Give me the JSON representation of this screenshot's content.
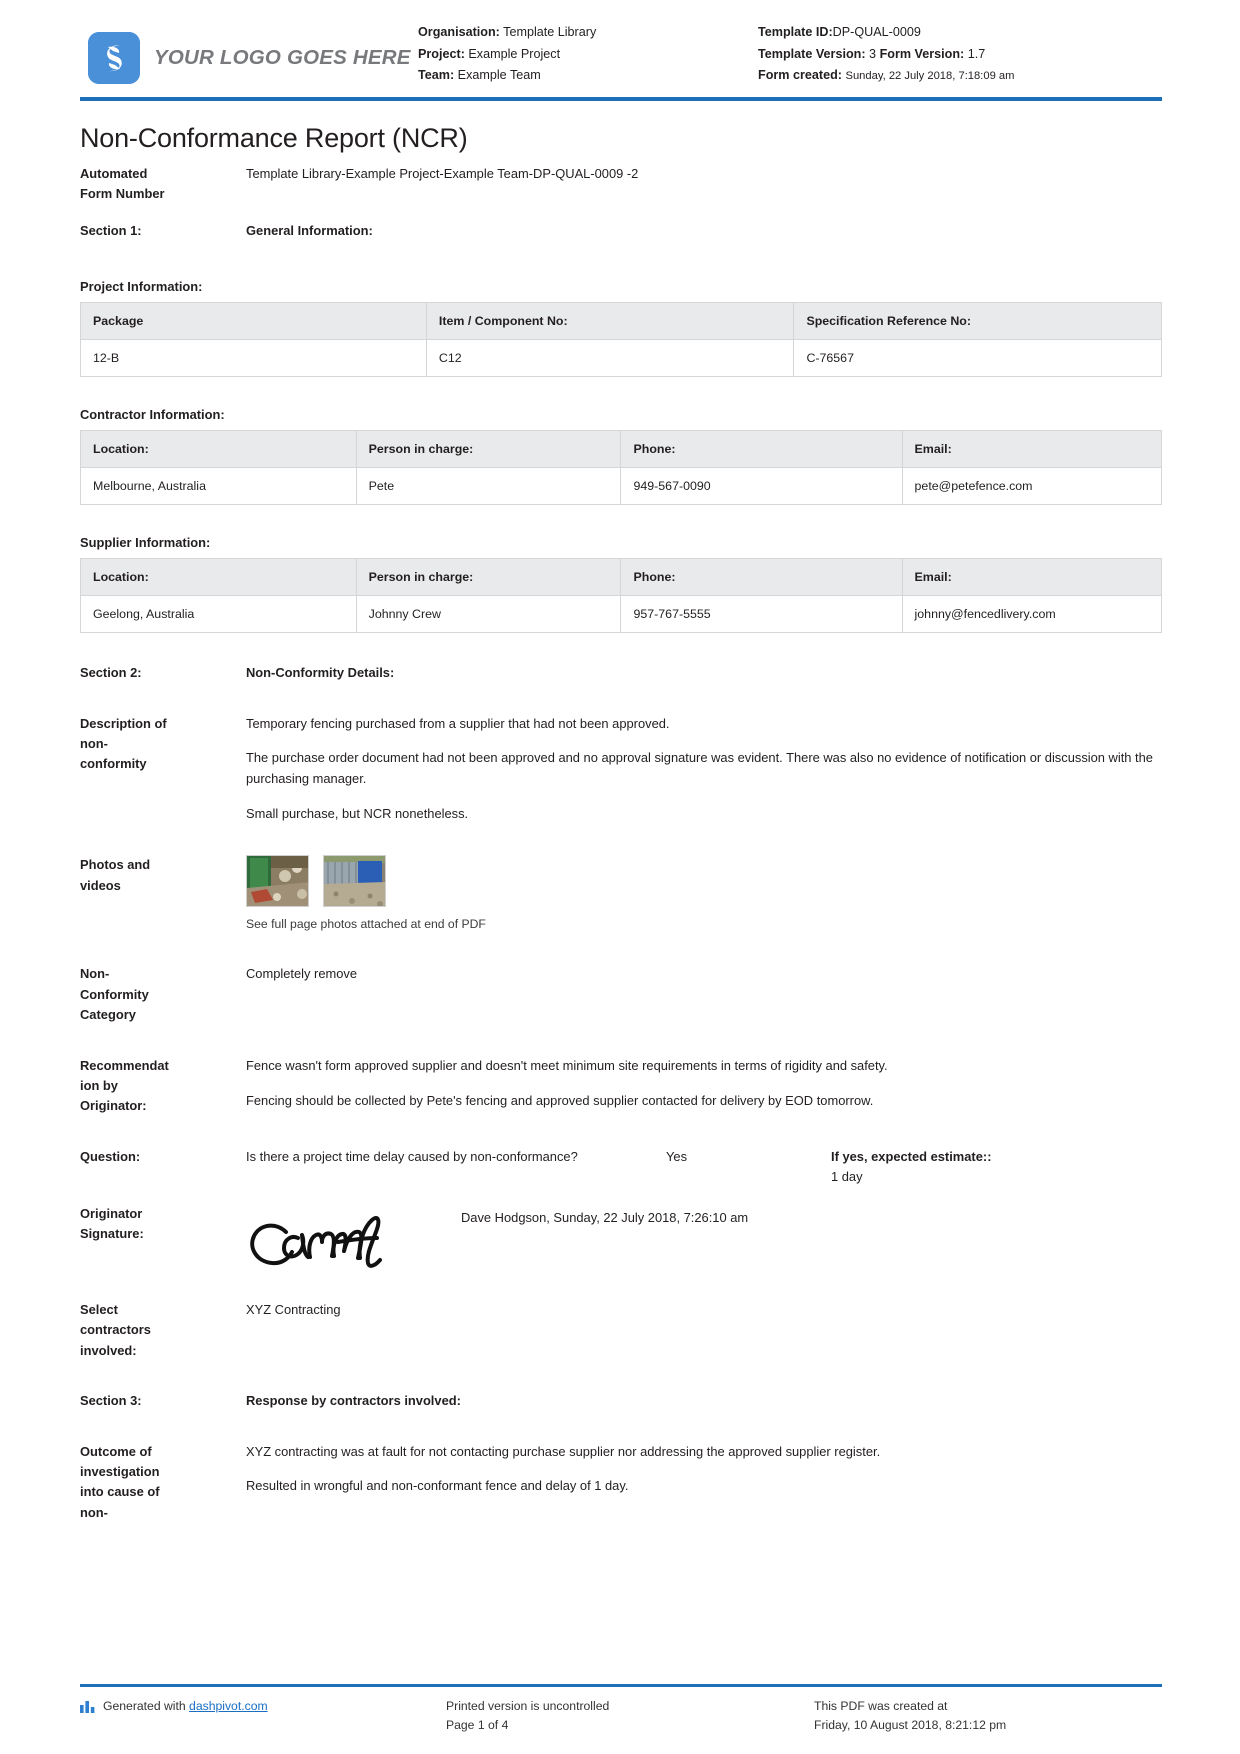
{
  "header": {
    "logo_text": "YOUR LOGO GOES HERE",
    "organisation_label": "Organisation:",
    "organisation_value": "Template Library",
    "project_label": "Project:",
    "project_value": "Example Project",
    "team_label": "Team:",
    "team_value": "Example Team",
    "template_id_label": "Template ID:",
    "template_id_value": "DP-QUAL-0009",
    "template_version_label": "Template Version:",
    "template_version_value": "3",
    "form_version_label": "Form Version:",
    "form_version_value": "1.7",
    "form_created_label": "Form created:",
    "form_created_value": "Sunday, 22 July 2018, 7:18:09 am"
  },
  "title": "Non-Conformance Report (NCR)",
  "automated_form": {
    "label_line1": "Automated",
    "label_line2": "Form Number",
    "value": "Template Library-Example Project-Example Team-DP-QUAL-0009   -2"
  },
  "section1": {
    "label": "Section 1:",
    "heading": "General Information:"
  },
  "project_information": {
    "heading": "Project Information:",
    "columns": [
      "Package",
      "Item / Component No:",
      "Specification Reference No:"
    ],
    "rows": [
      [
        "12-B",
        "C12",
        "C-76567"
      ]
    ]
  },
  "contractor_information": {
    "heading": "Contractor Information:",
    "columns": [
      "Location:",
      "Person in charge:",
      "Phone:",
      "Email:"
    ],
    "rows": [
      [
        "Melbourne, Australia",
        "Pete",
        "949-567-0090",
        "pete@petefence.com"
      ]
    ]
  },
  "supplier_information": {
    "heading": "Supplier Information:",
    "columns": [
      "Location:",
      "Person in charge:",
      "Phone:",
      "Email:"
    ],
    "rows": [
      [
        "Geelong, Australia",
        "Johnny Crew",
        "957-767-5555",
        "johnny@fencedlivery.com"
      ]
    ]
  },
  "section2": {
    "label": "Section 2:",
    "heading": "Non-Conformity Details:"
  },
  "description": {
    "label_line1": "Description of",
    "label_line2": "non-",
    "label_line3": "conformity",
    "paragraphs": [
      "Temporary fencing purchased from a supplier that had not been approved.",
      "The purchase order document had not been approved and no approval signature was evident. There was also no evidence of notification or discussion with the purchasing manager.",
      "Small purchase, but NCR nonetheless."
    ]
  },
  "photos": {
    "label_line1": "Photos and",
    "label_line2": "videos",
    "caption": "See full page photos attached at end of PDF",
    "count": 2
  },
  "category": {
    "label_line1": "Non-",
    "label_line2": "Conformity",
    "label_line3": "Category",
    "value": "Completely remove"
  },
  "recommendation": {
    "label_line1": "Recommendat",
    "label_line2": "ion by",
    "label_line3": "Originator:",
    "paragraphs": [
      "Fence wasn't form approved supplier and doesn't meet minimum site requirements in terms of rigidity and safety.",
      "Fencing should be collected by Pete's fencing and approved supplier contacted for delivery by EOD tomorrow."
    ]
  },
  "question": {
    "label": "Question:",
    "text": "Is there a project time delay caused by non-conformance?",
    "answer": "Yes",
    "estimate_label": "If yes, expected estimate::",
    "estimate_value": "1 day"
  },
  "signature": {
    "label_line1": "Originator",
    "label_line2": "Signature:",
    "meta": "Dave Hodgson, Sunday, 22 July 2018, 7:26:10 am"
  },
  "contractors": {
    "label_line1": "Select",
    "label_line2": "contractors",
    "label_line3": "involved:",
    "value": "XYZ Contracting"
  },
  "section3": {
    "label": "Section 3:",
    "heading": "Response by contractors involved:"
  },
  "outcome": {
    "label_line1": "Outcome of",
    "label_line2": "investigation",
    "label_line3": "into cause of",
    "label_line4": "non-",
    "paragraphs": [
      "XYZ contracting was at fault for not contacting purchase supplier nor addressing the approved supplier register.",
      "Resulted in wrongful and non-conformant fence and delay of 1 day."
    ]
  },
  "footer": {
    "generated_prefix": "Generated with ",
    "generated_link": "dashpivot.com",
    "uncontrolled": "Printed version is uncontrolled",
    "page": "Page 1 of 4",
    "created_line1": "This PDF was created at",
    "created_line2": "Friday, 10 August 2018, 8:21:12 pm"
  },
  "colors": {
    "accent_blue": "#1c6fb8",
    "logo_blue": "#4a90d9",
    "table_header": "#e9eaeb",
    "link": "#1a6fc4"
  }
}
